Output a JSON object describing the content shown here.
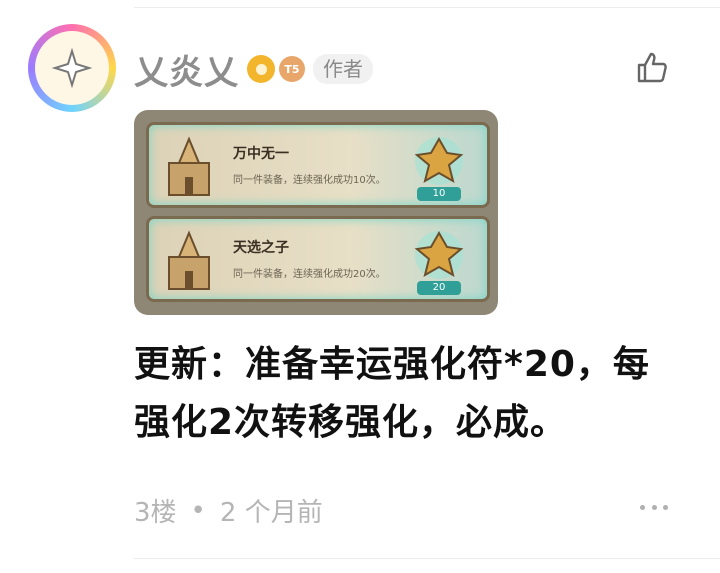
{
  "post": {
    "username": "乂炎乂",
    "level_badge": "T5",
    "author_tag": "作者",
    "content_line1": "更新：准备幸运强化符*20，每",
    "content_line2": "强化2次转移强化，必成。",
    "floor": "3楼",
    "separator": "•",
    "time_ago": "2 个月前"
  },
  "screenshot": {
    "cards": [
      {
        "title": "万中无一",
        "desc": "同一件装备，连续强化成功10次。",
        "count": "10"
      },
      {
        "title": "天选之子",
        "desc": "同一件装备，连续强化成功20次。",
        "count": "20"
      }
    ]
  },
  "icons": {
    "like": "thumb-up-icon",
    "more": "more-dots-icon"
  },
  "colors": {
    "username": "#8d8d8d",
    "meta": "#b5b5b5",
    "author_tag_bg": "#f1f1f1"
  }
}
